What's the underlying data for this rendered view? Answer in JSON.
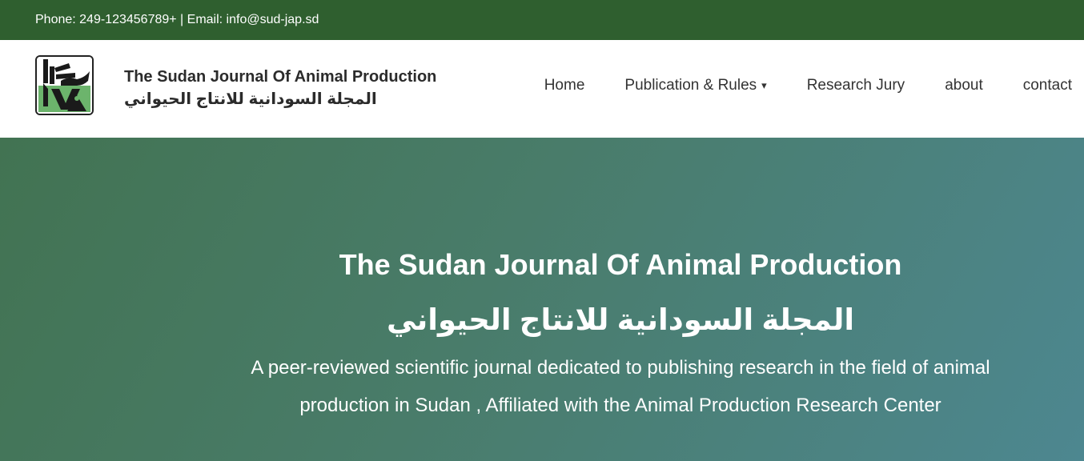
{
  "topbar": {
    "contact": "Phone: 249-123456789+ | Email: info@sud-jap.sd"
  },
  "brand": {
    "title_en": "The Sudan Journal Of Animal Production",
    "title_ar": "المجلة السودانية للانتاج الحيواني",
    "logo_icon": "journal-logo-icon"
  },
  "nav": {
    "items": [
      {
        "label": "Home"
      },
      {
        "label": "Publication & Rules",
        "caret": "▾"
      },
      {
        "label": "Research Jury"
      },
      {
        "label": "about"
      },
      {
        "label": "contact"
      }
    ]
  },
  "hero": {
    "title_en": "The Sudan Journal Of Animal Production",
    "title_ar": "المجلة السودانية للانتاج الحيواني",
    "description": "A peer-reviewed scientific journal dedicated to publishing research in the field of animal production in Sudan , Affiliated with the Animal Production Research Center"
  },
  "colors": {
    "topbar": "#2f5f2f",
    "hero_start": "#427352",
    "hero_end": "#4d8790",
    "logo_green": "#6cb46c"
  }
}
